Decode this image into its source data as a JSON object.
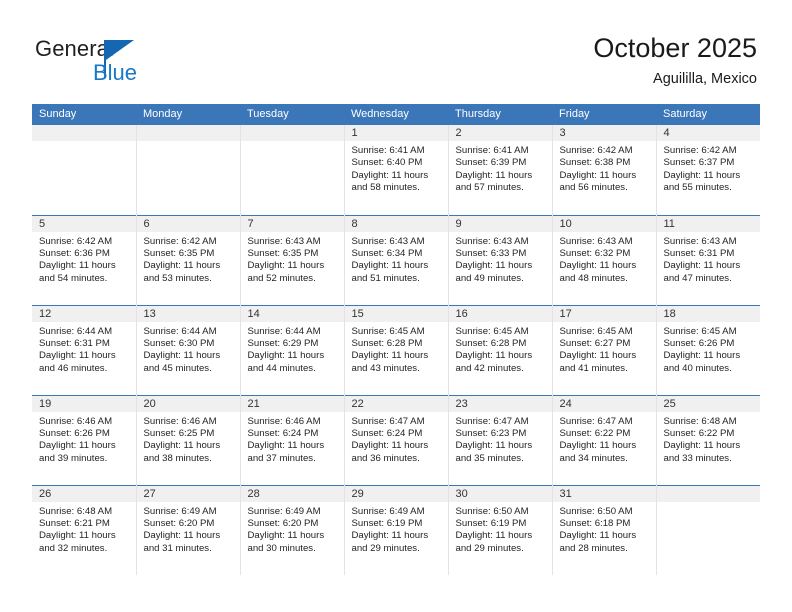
{
  "brand": {
    "name_top": "General",
    "name_bottom": "Blue",
    "flag_icon": "triangle-flag-icon",
    "accent_color": "#1878c8"
  },
  "header": {
    "title": "October 2025",
    "subtitle": "Aguililla, Mexico"
  },
  "theme": {
    "header_row_bg": "#3a76b8",
    "header_row_text": "#ffffff",
    "daynum_strip_bg": "#f0f0f0",
    "cell_bg": "#ffffff",
    "row_divider": "#3a76b8",
    "col_divider": "#e3e3e3",
    "body_text": "#231f20"
  },
  "weekdays": [
    "Sunday",
    "Monday",
    "Tuesday",
    "Wednesday",
    "Thursday",
    "Friday",
    "Saturday"
  ],
  "labels": {
    "sunrise_prefix": "Sunrise:",
    "sunset_prefix": "Sunset:",
    "daylight_prefix": "Daylight:"
  },
  "weeks": [
    [
      {
        "empty": true
      },
      {
        "empty": true
      },
      {
        "empty": true
      },
      {
        "day": "1",
        "sunrise": "Sunrise: 6:41 AM",
        "sunset": "Sunset: 6:40 PM",
        "daylight_l1": "Daylight: 11 hours",
        "daylight_l2": "and 58 minutes."
      },
      {
        "day": "2",
        "sunrise": "Sunrise: 6:41 AM",
        "sunset": "Sunset: 6:39 PM",
        "daylight_l1": "Daylight: 11 hours",
        "daylight_l2": "and 57 minutes."
      },
      {
        "day": "3",
        "sunrise": "Sunrise: 6:42 AM",
        "sunset": "Sunset: 6:38 PM",
        "daylight_l1": "Daylight: 11 hours",
        "daylight_l2": "and 56 minutes."
      },
      {
        "day": "4",
        "sunrise": "Sunrise: 6:42 AM",
        "sunset": "Sunset: 6:37 PM",
        "daylight_l1": "Daylight: 11 hours",
        "daylight_l2": "and 55 minutes."
      }
    ],
    [
      {
        "day": "5",
        "sunrise": "Sunrise: 6:42 AM",
        "sunset": "Sunset: 6:36 PM",
        "daylight_l1": "Daylight: 11 hours",
        "daylight_l2": "and 54 minutes."
      },
      {
        "day": "6",
        "sunrise": "Sunrise: 6:42 AM",
        "sunset": "Sunset: 6:35 PM",
        "daylight_l1": "Daylight: 11 hours",
        "daylight_l2": "and 53 minutes."
      },
      {
        "day": "7",
        "sunrise": "Sunrise: 6:43 AM",
        "sunset": "Sunset: 6:35 PM",
        "daylight_l1": "Daylight: 11 hours",
        "daylight_l2": "and 52 minutes."
      },
      {
        "day": "8",
        "sunrise": "Sunrise: 6:43 AM",
        "sunset": "Sunset: 6:34 PM",
        "daylight_l1": "Daylight: 11 hours",
        "daylight_l2": "and 51 minutes."
      },
      {
        "day": "9",
        "sunrise": "Sunrise: 6:43 AM",
        "sunset": "Sunset: 6:33 PM",
        "daylight_l1": "Daylight: 11 hours",
        "daylight_l2": "and 49 minutes."
      },
      {
        "day": "10",
        "sunrise": "Sunrise: 6:43 AM",
        "sunset": "Sunset: 6:32 PM",
        "daylight_l1": "Daylight: 11 hours",
        "daylight_l2": "and 48 minutes."
      },
      {
        "day": "11",
        "sunrise": "Sunrise: 6:43 AM",
        "sunset": "Sunset: 6:31 PM",
        "daylight_l1": "Daylight: 11 hours",
        "daylight_l2": "and 47 minutes."
      }
    ],
    [
      {
        "day": "12",
        "sunrise": "Sunrise: 6:44 AM",
        "sunset": "Sunset: 6:31 PM",
        "daylight_l1": "Daylight: 11 hours",
        "daylight_l2": "and 46 minutes."
      },
      {
        "day": "13",
        "sunrise": "Sunrise: 6:44 AM",
        "sunset": "Sunset: 6:30 PM",
        "daylight_l1": "Daylight: 11 hours",
        "daylight_l2": "and 45 minutes."
      },
      {
        "day": "14",
        "sunrise": "Sunrise: 6:44 AM",
        "sunset": "Sunset: 6:29 PM",
        "daylight_l1": "Daylight: 11 hours",
        "daylight_l2": "and 44 minutes."
      },
      {
        "day": "15",
        "sunrise": "Sunrise: 6:45 AM",
        "sunset": "Sunset: 6:28 PM",
        "daylight_l1": "Daylight: 11 hours",
        "daylight_l2": "and 43 minutes."
      },
      {
        "day": "16",
        "sunrise": "Sunrise: 6:45 AM",
        "sunset": "Sunset: 6:28 PM",
        "daylight_l1": "Daylight: 11 hours",
        "daylight_l2": "and 42 minutes."
      },
      {
        "day": "17",
        "sunrise": "Sunrise: 6:45 AM",
        "sunset": "Sunset: 6:27 PM",
        "daylight_l1": "Daylight: 11 hours",
        "daylight_l2": "and 41 minutes."
      },
      {
        "day": "18",
        "sunrise": "Sunrise: 6:45 AM",
        "sunset": "Sunset: 6:26 PM",
        "daylight_l1": "Daylight: 11 hours",
        "daylight_l2": "and 40 minutes."
      }
    ],
    [
      {
        "day": "19",
        "sunrise": "Sunrise: 6:46 AM",
        "sunset": "Sunset: 6:26 PM",
        "daylight_l1": "Daylight: 11 hours",
        "daylight_l2": "and 39 minutes."
      },
      {
        "day": "20",
        "sunrise": "Sunrise: 6:46 AM",
        "sunset": "Sunset: 6:25 PM",
        "daylight_l1": "Daylight: 11 hours",
        "daylight_l2": "and 38 minutes."
      },
      {
        "day": "21",
        "sunrise": "Sunrise: 6:46 AM",
        "sunset": "Sunset: 6:24 PM",
        "daylight_l1": "Daylight: 11 hours",
        "daylight_l2": "and 37 minutes."
      },
      {
        "day": "22",
        "sunrise": "Sunrise: 6:47 AM",
        "sunset": "Sunset: 6:24 PM",
        "daylight_l1": "Daylight: 11 hours",
        "daylight_l2": "and 36 minutes."
      },
      {
        "day": "23",
        "sunrise": "Sunrise: 6:47 AM",
        "sunset": "Sunset: 6:23 PM",
        "daylight_l1": "Daylight: 11 hours",
        "daylight_l2": "and 35 minutes."
      },
      {
        "day": "24",
        "sunrise": "Sunrise: 6:47 AM",
        "sunset": "Sunset: 6:22 PM",
        "daylight_l1": "Daylight: 11 hours",
        "daylight_l2": "and 34 minutes."
      },
      {
        "day": "25",
        "sunrise": "Sunrise: 6:48 AM",
        "sunset": "Sunset: 6:22 PM",
        "daylight_l1": "Daylight: 11 hours",
        "daylight_l2": "and 33 minutes."
      }
    ],
    [
      {
        "day": "26",
        "sunrise": "Sunrise: 6:48 AM",
        "sunset": "Sunset: 6:21 PM",
        "daylight_l1": "Daylight: 11 hours",
        "daylight_l2": "and 32 minutes."
      },
      {
        "day": "27",
        "sunrise": "Sunrise: 6:49 AM",
        "sunset": "Sunset: 6:20 PM",
        "daylight_l1": "Daylight: 11 hours",
        "daylight_l2": "and 31 minutes."
      },
      {
        "day": "28",
        "sunrise": "Sunrise: 6:49 AM",
        "sunset": "Sunset: 6:20 PM",
        "daylight_l1": "Daylight: 11 hours",
        "daylight_l2": "and 30 minutes."
      },
      {
        "day": "29",
        "sunrise": "Sunrise: 6:49 AM",
        "sunset": "Sunset: 6:19 PM",
        "daylight_l1": "Daylight: 11 hours",
        "daylight_l2": "and 29 minutes."
      },
      {
        "day": "30",
        "sunrise": "Sunrise: 6:50 AM",
        "sunset": "Sunset: 6:19 PM",
        "daylight_l1": "Daylight: 11 hours",
        "daylight_l2": "and 29 minutes."
      },
      {
        "day": "31",
        "sunrise": "Sunrise: 6:50 AM",
        "sunset": "Sunset: 6:18 PM",
        "daylight_l1": "Daylight: 11 hours",
        "daylight_l2": "and 28 minutes."
      },
      {
        "empty": true
      }
    ]
  ]
}
